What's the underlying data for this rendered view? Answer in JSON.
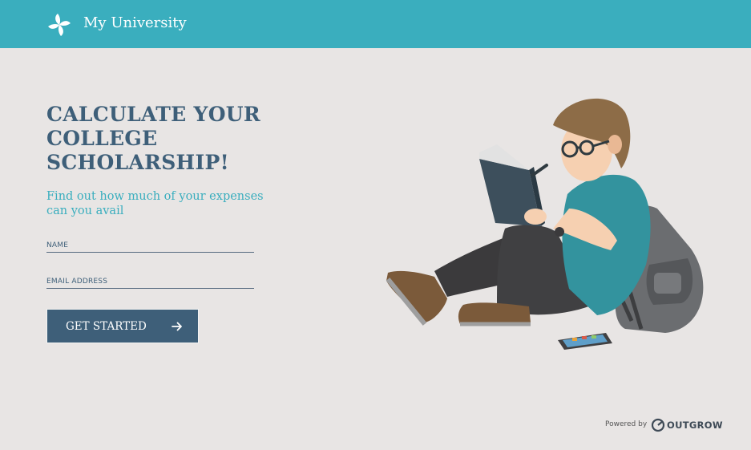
{
  "header": {
    "brand_name": "My University",
    "logo_icon": "pinwheel-icon",
    "background_color": "#3aaebe"
  },
  "hero": {
    "title": "CALCULATE YOUR COLLEGE SCHOLARSHIP!",
    "subtitle": "Find out how much of your expenses can you avail",
    "illustration": "student-reading-illustration"
  },
  "form": {
    "name_placeholder": "NAME",
    "name_value": "",
    "email_placeholder": "EMAIL ADDRESS",
    "email_value": "",
    "submit_label": "GET STARTED",
    "submit_icon": "arrow-right-icon"
  },
  "footer": {
    "powered_by": "Powered by",
    "provider_name": "OUTGROW",
    "provider_icon": "outgrow-logo-icon"
  },
  "colors": {
    "accent": "#3aaebe",
    "primary": "#3e5f79",
    "page_background": "#e8e5e4"
  }
}
